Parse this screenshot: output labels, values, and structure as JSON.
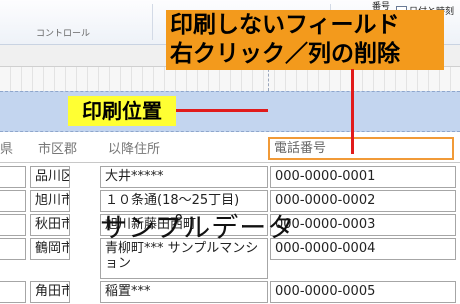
{
  "ribbon": {
    "group_label": "コントロール",
    "page_number_label": "番号",
    "datetime_label": "日付と時刻"
  },
  "callouts": {
    "no_print_field_line1": "印刷しないフィールド",
    "no_print_field_line2": "右クリック／列の削除",
    "print_position": "印刷位置",
    "sample_data": "サンプルデータ"
  },
  "headers": {
    "prefecture": "県",
    "city": "市区郡",
    "address": "以降住所",
    "phone": "電話番号"
  },
  "rows": [
    {
      "prefecture": "",
      "city": "品川区",
      "address": "大井*****",
      "phone": "000-0000-0001"
    },
    {
      "prefecture": "",
      "city": "旭川市",
      "address": "１０条通(18～25丁目)",
      "phone": "000-0000-0002"
    },
    {
      "prefecture": "",
      "city": "秋田市",
      "address": "旭川新藤田西町",
      "phone": "000-0000-0003"
    },
    {
      "prefecture": "",
      "city": "鶴岡市",
      "address": "青柳町*** サンプルマンション",
      "phone": "000-0000-0004"
    },
    {
      "prefecture": "",
      "city": "角田市",
      "address": "稲置***",
      "phone": "000-0000-0005"
    }
  ],
  "colors": {
    "print_band": "#c3d5ef",
    "callout_orange": "#f39a1c",
    "callout_yellow": "#ffff33",
    "pointer_red": "#e11b1b",
    "selected_field_border": "#f19a37"
  }
}
